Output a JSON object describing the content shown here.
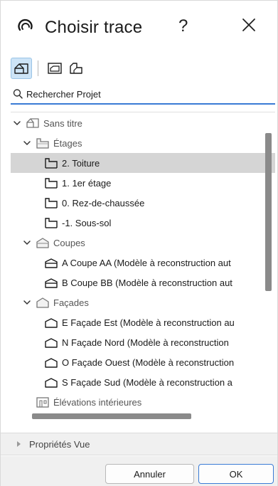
{
  "window": {
    "title": "Choisir trace",
    "help_label": "?",
    "close_label": "×"
  },
  "toolbar": {
    "buttons": [
      "view-map-icon",
      "layout-book-icon",
      "publisher-sets-icon"
    ],
    "active": 0
  },
  "search": {
    "placeholder": "Rechercher Projet",
    "value": ""
  },
  "tree": {
    "items": [
      {
        "label": "Sans titre",
        "kind": "project",
        "level": 0,
        "expanded": true
      },
      {
        "label": "Étages",
        "kind": "story-folder",
        "level": 1,
        "expanded": true
      },
      {
        "label": "2. Toiture",
        "kind": "story",
        "level": 2,
        "selected": true
      },
      {
        "label": "1. 1er étage",
        "kind": "story",
        "level": 2
      },
      {
        "label": "0. Rez-de-chaussée",
        "kind": "story",
        "level": 2
      },
      {
        "label": "-1. Sous-sol",
        "kind": "story",
        "level": 2
      },
      {
        "label": "Coupes",
        "kind": "section-folder",
        "level": 1,
        "expanded": true
      },
      {
        "label": "A Coupe AA (Modèle à reconstruction aut",
        "kind": "section",
        "level": 2
      },
      {
        "label": "B Coupe BB (Modèle à reconstruction aut",
        "kind": "section",
        "level": 2
      },
      {
        "label": "Façades",
        "kind": "elevation-folder",
        "level": 1,
        "expanded": true
      },
      {
        "label": "E Façade Est (Modèle à reconstruction au",
        "kind": "elevation",
        "level": 2
      },
      {
        "label": "N Façade Nord (Modèle à reconstruction",
        "kind": "elevation",
        "level": 2
      },
      {
        "label": "O Façade Ouest (Modèle à reconstruction",
        "kind": "elevation",
        "level": 2
      },
      {
        "label": "S Façade Sud (Modèle à reconstruction a",
        "kind": "elevation",
        "level": 2
      },
      {
        "label": "Élévations intérieures",
        "kind": "interior-folder",
        "level": 1
      }
    ]
  },
  "properties": {
    "label": "Propriétés Vue"
  },
  "buttons": {
    "cancel": "Annuler",
    "ok": "OK"
  },
  "colors": {
    "accent": "#3a7bd5",
    "selection": "#d5d5d5",
    "toolbar_active": "#cde4f7"
  }
}
